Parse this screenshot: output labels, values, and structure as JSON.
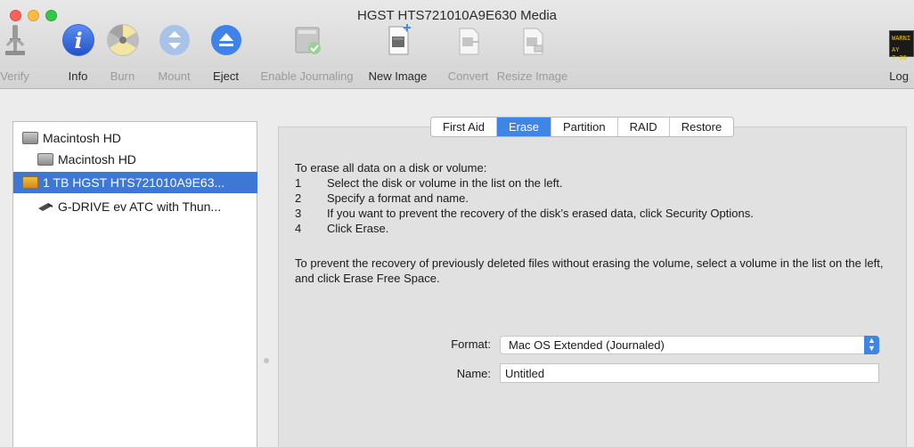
{
  "window": {
    "title": "HGST HTS721010A9E630 Media"
  },
  "toolbar": {
    "verify": "Verify",
    "info": "Info",
    "burn": "Burn",
    "mount": "Mount",
    "eject": "Eject",
    "enable_journaling": "Enable Journaling",
    "new_image": "New Image",
    "convert": "Convert",
    "resize_image": "Resize Image",
    "log": "Log",
    "log_icon_text_line1": "WARNI",
    "log_icon_text_line2": "AY 7:36"
  },
  "sidebar": {
    "items": [
      {
        "label": "Macintosh HD",
        "icon": "hard-disk-icon"
      },
      {
        "label": "Macintosh HD",
        "icon": "volume-icon"
      },
      {
        "label": "1 TB HGST HTS721010A9E63...",
        "icon": "external-disk-icon",
        "selected": true
      },
      {
        "label": "G-DRIVE ev ATC with Thun...",
        "icon": "removable-volume-icon"
      }
    ]
  },
  "tabs": [
    "First Aid",
    "Erase",
    "Partition",
    "RAID",
    "Restore"
  ],
  "active_tab": "Erase",
  "erase": {
    "intro": "To erase all data on a disk or volume:",
    "steps": [
      {
        "n": "1",
        "text": "Select the disk or volume in the list on the left."
      },
      {
        "n": "2",
        "text": "Specify a format and name."
      },
      {
        "n": "3",
        "text": "If you want to prevent the recovery of the disk’s erased data, click Security Options."
      },
      {
        "n": "4",
        "text": "Click Erase."
      }
    ],
    "note": "To prevent the recovery of previously deleted files without erasing the volume, select a volume in the list on the left, and click Erase Free Space.",
    "format_label": "Format:",
    "format_value": "Mac OS Extended (Journaled)",
    "name_label": "Name:",
    "name_value": "Untitled"
  },
  "colors": {
    "accent": "#3d85e6",
    "selection": "#3f78d4"
  }
}
